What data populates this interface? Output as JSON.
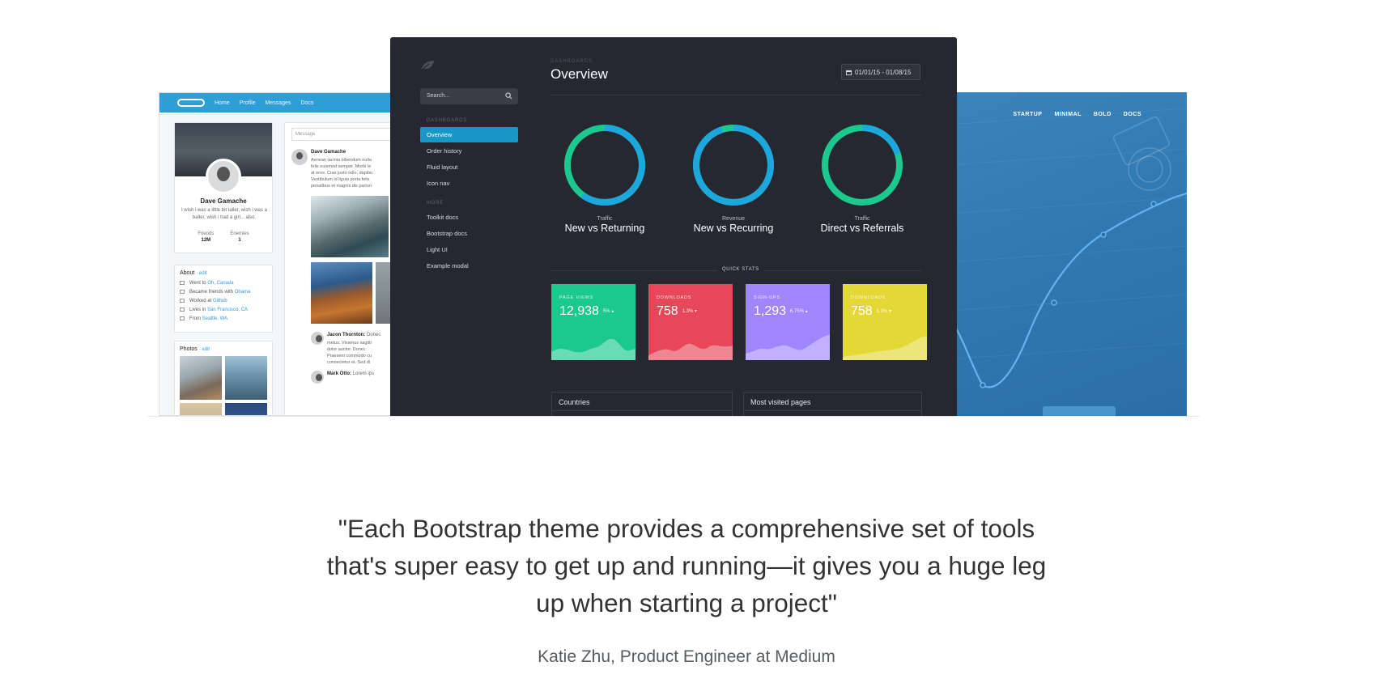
{
  "social_theme": {
    "nav_links": [
      "Home",
      "Profile",
      "Messages",
      "Docs"
    ],
    "profile": {
      "name": "Dave Gamache",
      "bio": "I wish i was a little bit taller, wish i was a baller, wish i had a girl... also.",
      "friends_label": "Friends",
      "friends_value": "12M",
      "enemies_label": "Enemies",
      "enemies_value": "1"
    },
    "about": {
      "heading": "About",
      "edit_label": "· edit",
      "rows": [
        {
          "prefix": "Went to ",
          "link": "Oh, Canada"
        },
        {
          "prefix": "Became friends with ",
          "link": "Obama"
        },
        {
          "prefix": "Worked at ",
          "link": "Github"
        },
        {
          "prefix": "Lives in ",
          "link": "San Francisco, CA"
        },
        {
          "prefix": "From ",
          "link": "Seattle, WA"
        }
      ]
    },
    "photos": {
      "heading": "Photos",
      "edit_label": "· edit"
    },
    "feed": {
      "message_placeholder": "Message",
      "post_author": "Dave Gamache",
      "post_text": [
        "Aenean lacinia bibendum nulla",
        "felis euismod semper. Morbi le",
        "at eros. Cras justo odio, dapibu",
        "Vestibulum id ligula porta felis",
        "penatibus et magnis dis parturi"
      ],
      "comment_author": "Jacon Thornton:",
      "comment_author_suffix": " Donec",
      "comment_text": [
        "metus. Vivamus sagitti",
        "dolor auctor. Donec",
        "Praesent commodo cu",
        "consectetur et. Sed di"
      ],
      "comment2_author": "Mark Otto:",
      "comment2_suffix": " Lorem ips"
    }
  },
  "dashboard": {
    "search_placeholder": "Search...",
    "sections": [
      "DASHBOARDS",
      "MORE"
    ],
    "nav_dashboards": [
      "Overview",
      "Order history",
      "Fluid layout",
      "Icon nav"
    ],
    "nav_more": [
      "Toolkit docs",
      "Bootstrap docs",
      "Light UI",
      "Example modal"
    ],
    "breadcrumb": "DASHBOARDS",
    "title": "Overview",
    "date_range": "01/01/15 - 01/08/15",
    "donuts": [
      {
        "small": "Traffic",
        "big": "New vs Returning",
        "primary": 0.6,
        "primary_color": "#1ca8dd",
        "secondary_color": "#1bc98e"
      },
      {
        "small": "Revenue",
        "big": "New vs Recurring",
        "primary": 0.95,
        "primary_color": "#1ca8dd",
        "secondary_color": "#1bc98e"
      },
      {
        "small": "Traffic",
        "big": "Direct vs Referrals",
        "primary": 0.2,
        "primary_color": "#1ca8dd",
        "secondary_color": "#1bc98e"
      }
    ],
    "quick_stats_label": "QUICK STATS",
    "stats": [
      {
        "label": "PAGE VIEWS",
        "value": "12,938",
        "delta": "5% ▴",
        "color": "#1bc98e"
      },
      {
        "label": "DOWNLOADS",
        "value": "758",
        "delta": "1.3% ▾",
        "color": "#e64759"
      },
      {
        "label": "SIGN-UPS",
        "value": "1,293",
        "delta": "6.75% ▴",
        "color": "#9f86ff"
      },
      {
        "label": "DOWNLOADS",
        "value": "758",
        "delta": "1.3% ▾",
        "color": "#e4d836"
      }
    ],
    "panels": [
      "Countries",
      "Most visited pages"
    ]
  },
  "landing_theme": {
    "nav_links": [
      "STARTUP",
      "MINIMAL",
      "BOLD",
      "DOCS"
    ]
  },
  "testimonial": {
    "quote": "\"Each Bootstrap theme provides a comprehensive set of tools that's super easy to get up and running—it gives you a huge leg up when starting a project\"",
    "attribution": "Katie Zhu, Product Engineer at Medium"
  }
}
